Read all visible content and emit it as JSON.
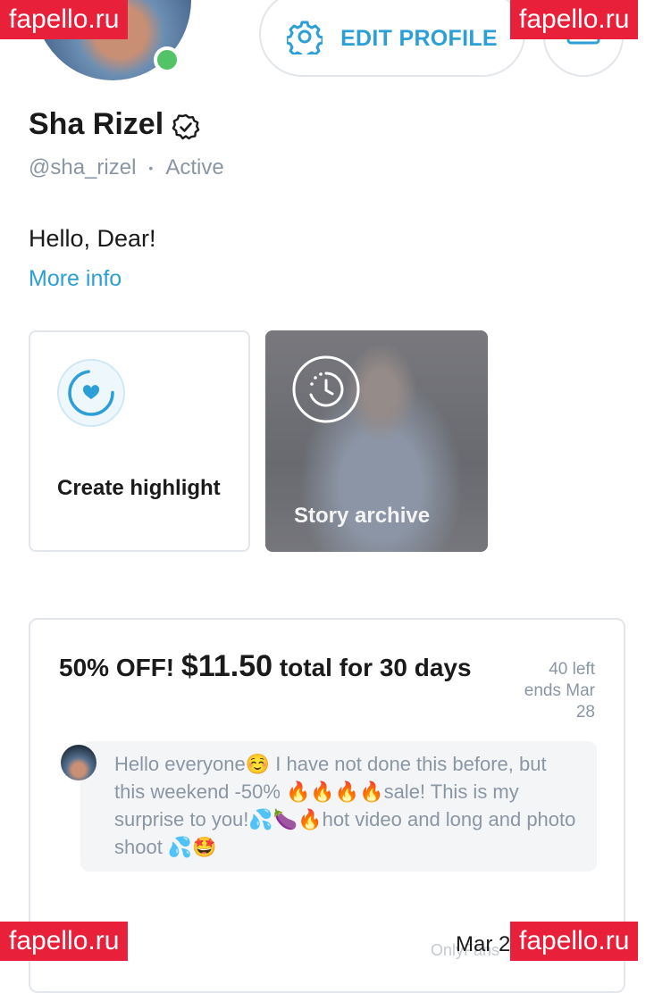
{
  "watermark": {
    "text": "fapello.ru"
  },
  "header": {
    "edit_label": "EDIT PROFILE"
  },
  "profile": {
    "name": "Sha Rizel",
    "handle": "@sha_rizel",
    "separator": "•",
    "status": "Active",
    "bio": "Hello, Dear!",
    "more_info": "More info"
  },
  "highlights": {
    "create_label": "Create highlight",
    "archive_label": "Story archive"
  },
  "promo": {
    "discount": "50% OFF!",
    "price": "$11.50",
    "terms": "total for 30 days",
    "left": "40 left",
    "ends": "ends Mar 28",
    "message": "Hello everyone☺️ I have not done this before, but this weekend -50% 🔥🔥🔥🔥sale! This is my surprise to you!💦🍆🔥hot video and long and photo shoot 💦🤩",
    "date": "Mar 2",
    "brand": "OnlyFans"
  },
  "colors": {
    "accent": "#2b9fd6",
    "online": "#53c466",
    "watermark_bg": "#e8203a",
    "muted": "#8a96a3"
  },
  "icons": [
    "gear-icon",
    "verified-icon",
    "create-highlight-icon",
    "story-archive-icon"
  ]
}
